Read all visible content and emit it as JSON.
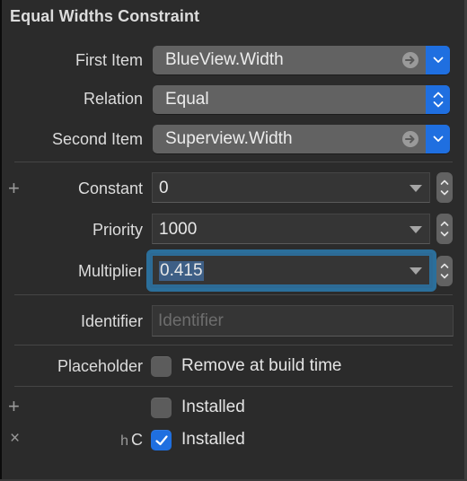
{
  "title": "Equal Widths Constraint",
  "first_item": {
    "label": "First Item",
    "value": "BlueView.Width",
    "goto_icon": "arrow-right-circle-icon",
    "chevron_icon": "chevron-down-icon"
  },
  "relation": {
    "label": "Relation",
    "value": "Equal",
    "chevron_icon": "chevron-up-down-icon"
  },
  "second_item": {
    "label": "Second Item",
    "value": "Superview.Width",
    "goto_icon": "arrow-right-circle-icon",
    "chevron_icon": "chevron-down-icon"
  },
  "constant": {
    "label": "Constant",
    "value": "0",
    "add_icon": "plus-icon"
  },
  "priority": {
    "label": "Priority",
    "value": "1000"
  },
  "multiplier": {
    "label": "Multiplier",
    "value": "0.415",
    "focused": true,
    "selected": true
  },
  "identifier": {
    "label": "Identifier",
    "value": "",
    "placeholder": "Identifier"
  },
  "placeholder": {
    "label": "Placeholder",
    "checkbox_label": "Remove at build time",
    "checked": false
  },
  "installed": [
    {
      "side_icon": "plus-icon",
      "size_class": "",
      "label": "Installed",
      "checked": false
    },
    {
      "side_icon": "close-icon",
      "size_class_h": "h",
      "size_class_v": "C",
      "label": "Installed",
      "checked": true
    }
  ],
  "colors": {
    "accent": "#1f6fe0",
    "focus_ring": "#2b6f9b",
    "background": "#2b2b2b",
    "popup": "#626262"
  }
}
